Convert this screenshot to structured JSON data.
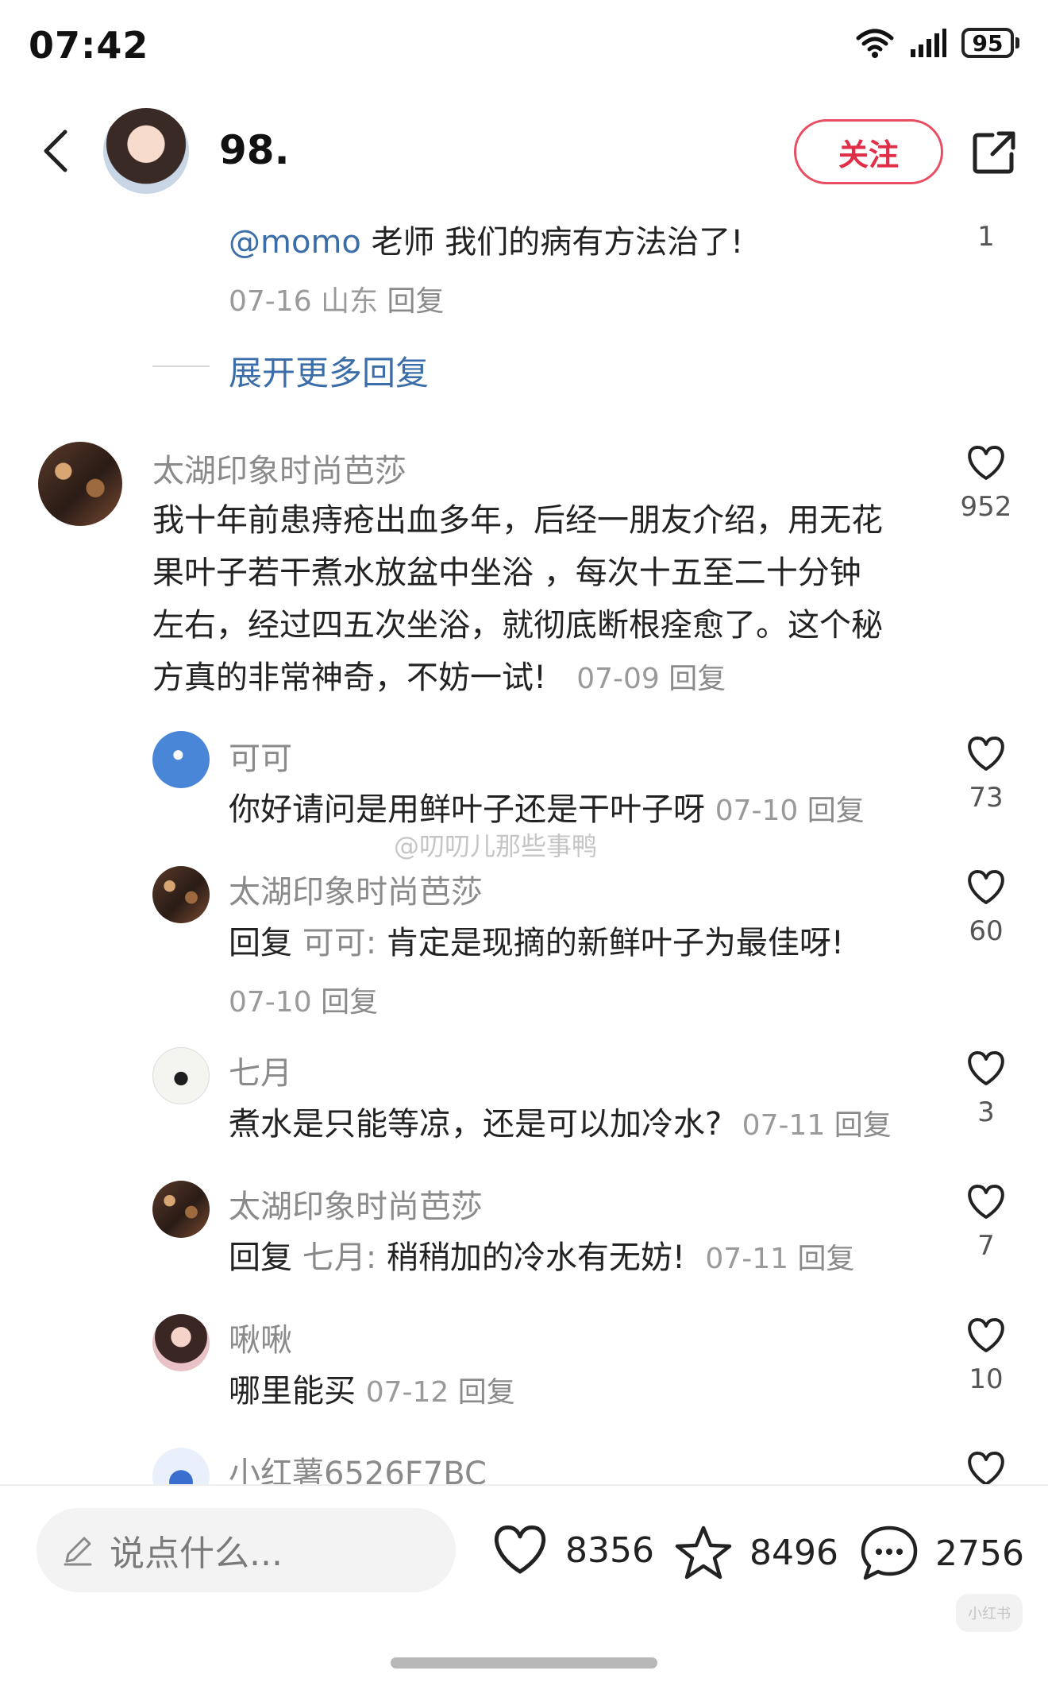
{
  "status_bar": {
    "time": "07:42",
    "battery": "95"
  },
  "header": {
    "author_name": "98.",
    "follow_label": "关注"
  },
  "top_reply": {
    "mention": "@momo",
    "text": " 老师 我们的病有方法治了!",
    "date": "07-16",
    "location": "山东",
    "reply_label": "回复",
    "like_count": "1"
  },
  "expand_label": "展开更多回复",
  "main_comment": {
    "username": "太湖印象时尚芭莎",
    "lines": [
      "我十年前患痔疮出血多年，后经一朋友介绍，用无花",
      "果叶子若干煮水放盆中坐浴 ，每次十五至二十分钟",
      "左右，经过四五次坐浴，就彻底断根痊愈了。这个秘",
      "方真的非常神奇，不妨一试!"
    ],
    "date": "07-09",
    "reply_label": "回复",
    "like_count": "952"
  },
  "replies": [
    {
      "username": "可可",
      "text": "你好请问是用鲜叶子还是干叶子呀",
      "date": "07-10",
      "reply_label": "回复",
      "like_count": "73"
    },
    {
      "username": "太湖印象时尚芭莎",
      "reply_prefix": "回复",
      "reply_to": "可可:",
      "text": " 肯定是现摘的新鲜叶子为最佳呀!",
      "date": "07-10",
      "reply_label": "回复",
      "like_count": "60"
    },
    {
      "username": "七月",
      "text": "煮水是只能等凉，还是可以加冷水?",
      "date": "07-11",
      "reply_label": "回复",
      "like_count": "3"
    },
    {
      "username": "太湖印象时尚芭莎",
      "reply_prefix": "回复",
      "reply_to": "七月:",
      "text": " 稍稍加的冷水有无妨!",
      "date": "07-11",
      "reply_label": "回复",
      "like_count": "7"
    },
    {
      "username": "啾啾",
      "text": "哪里能买",
      "date": "07-12",
      "reply_label": "回复",
      "like_count": "10"
    },
    {
      "username": "小红薯6526F7BC"
    }
  ],
  "watermark": "@叨叨儿那些事鸭",
  "bottom_bar": {
    "input_placeholder": "说点什么...",
    "likes": "8356",
    "favorites": "8496",
    "comments": "2756"
  },
  "corner_logo": "小红书",
  "colors": {
    "accent": "#e02e48",
    "link": "#3b6ea8"
  }
}
